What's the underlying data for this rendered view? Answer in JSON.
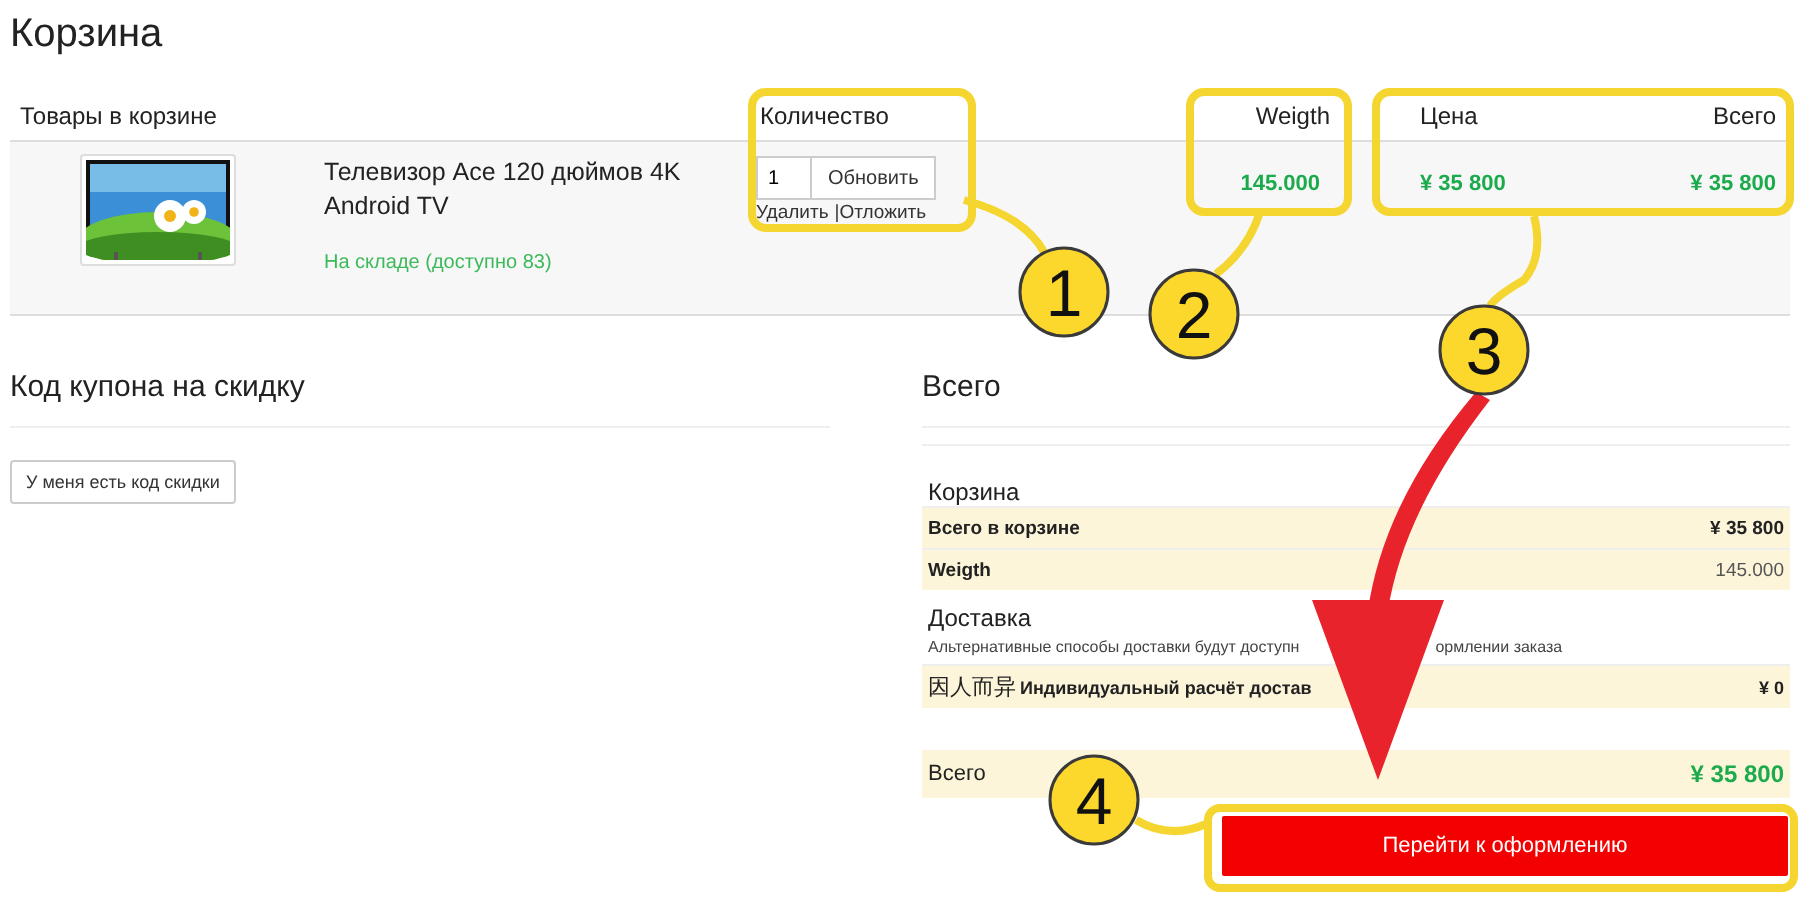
{
  "page_title": "Корзина",
  "cart": {
    "columns": [
      "Товары в корзине",
      "Количество",
      "Weigth",
      "Цена",
      "Всего"
    ],
    "item": {
      "name": "Телевизор Ace 120 дюймов 4K Android TV",
      "stock": "На складе (доступно 83)",
      "quantity": "1",
      "update_button": "Обновить",
      "remove_link": "Удалить",
      "separator": "|",
      "defer_link": "Отложить",
      "weight": "145.000",
      "price": "¥ 35 800",
      "total": "¥ 35 800"
    }
  },
  "coupon": {
    "title": "Код купона на скидку",
    "button": "У меня есть код скидки"
  },
  "totals": {
    "title": "Всего",
    "cart_heading": "Корзина",
    "rows": [
      {
        "label": "Всего в корзине",
        "value": "¥ 35 800",
        "kind": "bold"
      },
      {
        "label": "Weigth",
        "value": "145.000",
        "kind": "plain"
      }
    ],
    "shipping_heading": "Доставка",
    "shipping_note_parts": [
      "Альтернативные способы доставки будут доступн",
      "ормлении заказа"
    ],
    "shipping_option": {
      "tag": "因人而异",
      "label": "Индивидуальный расчёт достав",
      "value": "¥ 0"
    },
    "grand_total": {
      "label": "Всего",
      "value": "¥ 35 800"
    },
    "checkout_button": "Перейти к оформлению"
  },
  "annotations": [
    "1",
    "2",
    "3",
    "4"
  ]
}
